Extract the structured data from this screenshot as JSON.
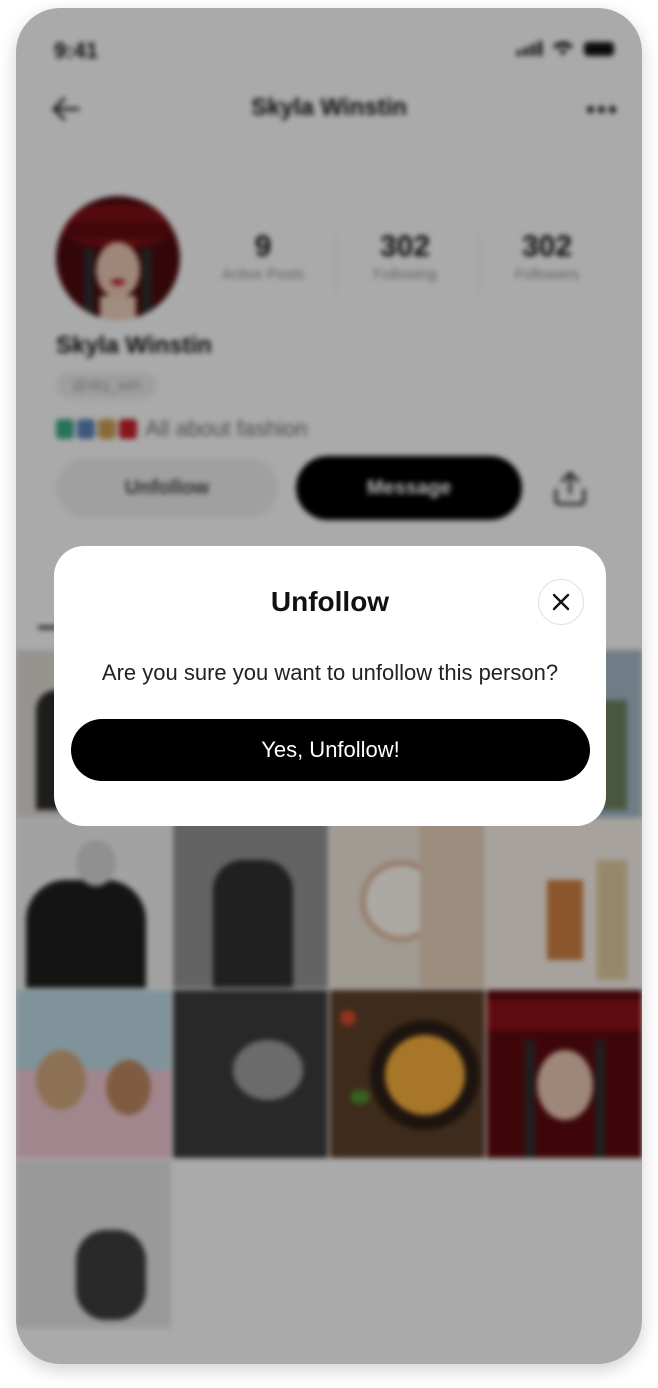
{
  "status_bar": {
    "time": "9:41"
  },
  "nav": {
    "title": "Skyla Winstin"
  },
  "profile": {
    "stats": [
      {
        "value": "9",
        "label": "Active Posts"
      },
      {
        "value": "302",
        "label": "Following"
      },
      {
        "value": "302",
        "label": "Followers"
      }
    ],
    "name": "Skyla  Winstin",
    "handle": "@sky_win",
    "bio": "All about fashion",
    "unfollow_label": "Unfollow",
    "message_label": "Message"
  },
  "modal": {
    "title": "Unfollow",
    "message": "Are you sure you want to unfollow this person?",
    "confirm_label": "Yes, Unfollow!"
  },
  "colors": {
    "primary_button": "#000000",
    "overlay": "rgba(0,0,0,0.30)",
    "modal_background": "#ffffff"
  },
  "icons": [
    "back-arrow-icon",
    "more-icon",
    "share-icon",
    "close-icon",
    "signal-icon",
    "wifi-icon",
    "battery-icon"
  ]
}
